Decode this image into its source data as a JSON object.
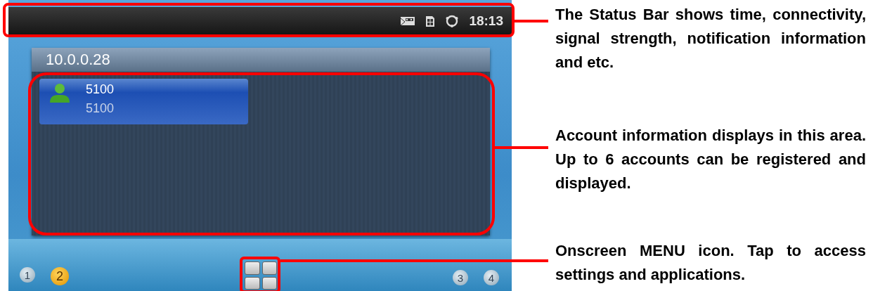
{
  "status_bar": {
    "time": "18:13"
  },
  "account_panel": {
    "server": "10.0.0.28",
    "accounts": [
      {
        "name": "5100",
        "number": "5100",
        "selected": true
      }
    ]
  },
  "pages_left": [
    {
      "label": "1",
      "selected": false
    },
    {
      "label": "2",
      "selected": true
    }
  ],
  "pages_right": [
    {
      "label": "3",
      "selected": false
    },
    {
      "label": "4",
      "selected": false
    }
  ],
  "annotations": [
    {
      "text": "The Status Bar shows time, connectivity, signal strength, notification information and etc."
    },
    {
      "text": "Account information displays in this area. Up to 6 accounts can be registered and displayed."
    },
    {
      "text": "Onscreen MENU icon. Tap to access settings and applications."
    }
  ]
}
